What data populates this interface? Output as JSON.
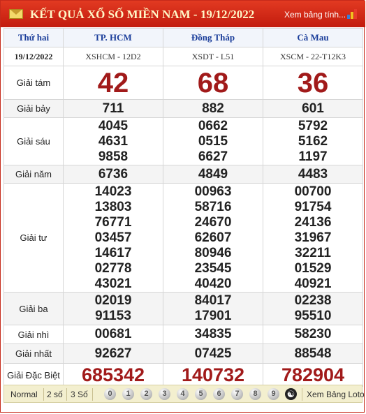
{
  "header": {
    "title": "KẾT QUẢ XỔ SỐ MIỀN NAM - 19/12/2022",
    "more_link": "Xem bảng tính..."
  },
  "columns": {
    "weekday": "Thứ hai",
    "date": "19/12/2022",
    "provinces": [
      {
        "name": "TP. HCM",
        "code": "XSHCM - 12D2"
      },
      {
        "name": "Đồng Tháp",
        "code": "XSDT - L51"
      },
      {
        "name": "Cà Mau",
        "code": "XSCM - 22-T12K3"
      }
    ]
  },
  "prizes": {
    "g8": {
      "label": "Giải tám",
      "values": [
        "42",
        "68",
        "36"
      ]
    },
    "g7": {
      "label": "Giải bảy",
      "values": [
        "711",
        "882",
        "601"
      ]
    },
    "g6": {
      "label": "Giải sáu",
      "values": [
        [
          "4045",
          "4631",
          "9858"
        ],
        [
          "0662",
          "0515",
          "6627"
        ],
        [
          "5792",
          "5162",
          "1197"
        ]
      ]
    },
    "g5": {
      "label": "Giải năm",
      "values": [
        "6736",
        "4849",
        "4483"
      ]
    },
    "g4": {
      "label": "Giải tư",
      "values": [
        [
          "14023",
          "13803",
          "76771",
          "03457",
          "14617",
          "02778",
          "43021"
        ],
        [
          "00963",
          "58716",
          "24670",
          "62607",
          "80946",
          "23545",
          "40420"
        ],
        [
          "00700",
          "91754",
          "24136",
          "31967",
          "32211",
          "01529",
          "40921"
        ]
      ]
    },
    "g3": {
      "label": "Giải ba",
      "values": [
        [
          "02019",
          "91153"
        ],
        [
          "84017",
          "17901"
        ],
        [
          "02238",
          "95510"
        ]
      ]
    },
    "g2": {
      "label": "Giải nhì",
      "values": [
        "00681",
        "34835",
        "58230"
      ]
    },
    "g1": {
      "label": "Giải nhất",
      "values": [
        "92627",
        "07425",
        "88548"
      ]
    },
    "db": {
      "label": "Giải Đặc Biệt",
      "values": [
        "685342",
        "140732",
        "782904"
      ]
    }
  },
  "footer": {
    "options": [
      "Normal",
      "2 số",
      "3 Số"
    ],
    "digits": [
      "0",
      "1",
      "2",
      "3",
      "4",
      "5",
      "6",
      "7",
      "8",
      "9"
    ],
    "yin_yang": "☯",
    "loto_link": "Xem Bảng Loto"
  },
  "colors": {
    "header_red": "#c21b0d",
    "prize_red": "#a11a1a",
    "province_blue": "#1a3d9a",
    "footer_bg": "#f3efcf"
  }
}
